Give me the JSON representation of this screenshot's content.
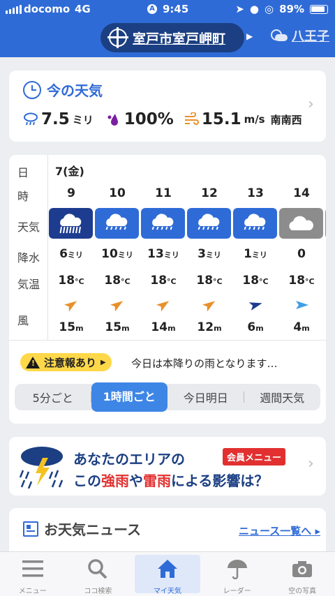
{
  "status_bar": {
    "carrier": "docomo",
    "network": "4G",
    "time": "9:45",
    "battery": "89%"
  },
  "header": {
    "location": "室戸市室戸岬町",
    "next_location": "八王子"
  },
  "now": {
    "title": "今の天気",
    "rain_value": "7.5",
    "rain_unit": "ミリ",
    "humidity_value": "100",
    "humidity_unit": "%",
    "wind_value": "15.1",
    "wind_unit": "m/s",
    "wind_dir": "南南西"
  },
  "forecast": {
    "row_labels": {
      "day": "日",
      "hour": "時",
      "weather": "天気",
      "rain": "降水",
      "temp": "気温",
      "wind": "風"
    },
    "day": "7(金)",
    "hours": [
      {
        "hour": "9",
        "icon": "heavy-rain-icon",
        "rain": "6",
        "rain_unit": "ミリ",
        "temp": "18",
        "temp_unit": "°C",
        "wind_dir": "southwest",
        "wind": "15",
        "wind_unit": "m"
      },
      {
        "hour": "10",
        "icon": "rain-icon",
        "rain": "10",
        "rain_unit": "ミリ",
        "temp": "18",
        "temp_unit": "°C",
        "wind_dir": "southwest",
        "wind": "15",
        "wind_unit": "m"
      },
      {
        "hour": "11",
        "icon": "rain-icon",
        "rain": "13",
        "rain_unit": "ミリ",
        "temp": "18",
        "temp_unit": "°C",
        "wind_dir": "southwest",
        "wind": "14",
        "wind_unit": "m"
      },
      {
        "hour": "12",
        "icon": "rain-icon",
        "rain": "3",
        "rain_unit": "ミリ",
        "temp": "18",
        "temp_unit": "°C",
        "wind_dir": "southwest",
        "wind": "12",
        "wind_unit": "m"
      },
      {
        "hour": "13",
        "icon": "rain-icon",
        "rain": "1",
        "rain_unit": "ミリ",
        "temp": "18",
        "temp_unit": "°C",
        "wind_dir": "west-southwest",
        "wind": "6",
        "wind_unit": "m"
      },
      {
        "hour": "14",
        "icon": "cloud-icon",
        "rain": "0",
        "rain_unit": "",
        "temp": "18",
        "temp_unit": "°C",
        "wind_dir": "west",
        "wind": "4",
        "wind_unit": "m"
      }
    ],
    "colors": {
      "heavy_rain": "#1d3c8f",
      "rain": "#2f6bd6",
      "cloudy": "#8c8c8c"
    },
    "alert_badge": "注意報あり",
    "alert_text": "今日は本降りの雨となります…",
    "tabs": [
      "5分ごと",
      "1時間ごと",
      "今日明日",
      "週間天気"
    ],
    "active_tab": "1時間ごと"
  },
  "ad": {
    "line1": "あなたのエリアの",
    "badge": "会員メニュー",
    "line2_a": "この",
    "line2_b": "強雨",
    "line2_c": "や",
    "line2_d": "雷雨",
    "line2_e": "による影響は？"
  },
  "news": {
    "title": "お天気ニュース",
    "link": "ニュース一覧へ"
  },
  "tabbar": [
    {
      "label": "メニュー",
      "icon": "menu-icon"
    },
    {
      "label": "ココ検索",
      "icon": "search-icon"
    },
    {
      "label": "マイ天気",
      "icon": "home-icon"
    },
    {
      "label": "レーダー",
      "icon": "radar-icon"
    },
    {
      "label": "空の写真",
      "icon": "camera-icon"
    }
  ]
}
